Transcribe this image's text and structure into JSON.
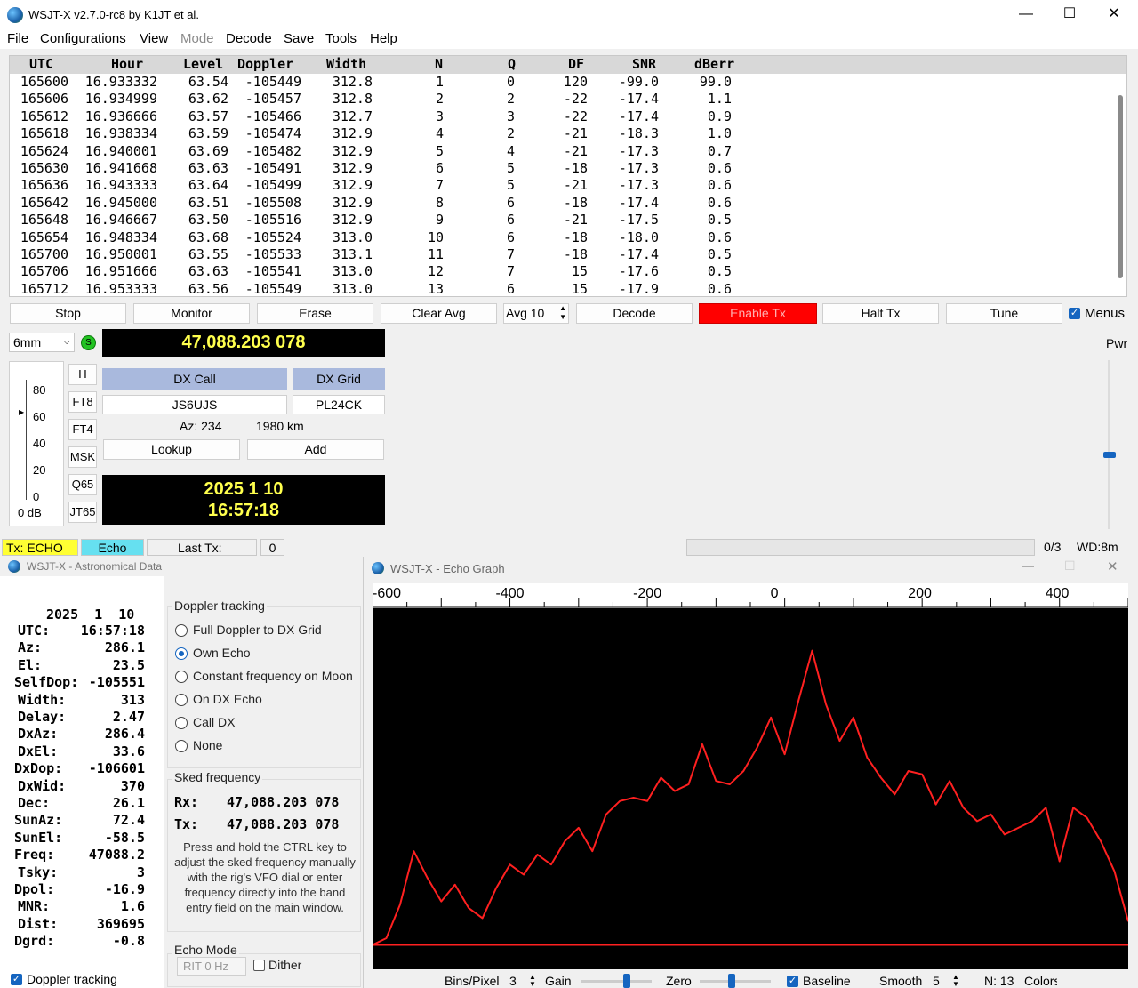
{
  "main": {
    "title": "WSJT-X   v2.7.0-rc8   by K1JT et al.",
    "menu": [
      "File",
      "Configurations",
      "View",
      "Mode",
      "Decode",
      "Save",
      "Tools",
      "Help"
    ],
    "table": {
      "headers": [
        "UTC",
        "Hour",
        "Level",
        "Doppler",
        "Width",
        "N",
        "Q",
        "DF",
        "SNR",
        "dBerr"
      ],
      "rows": [
        [
          "165600",
          "16.933332",
          "63.54",
          "-105449",
          "312.8",
          "1",
          "0",
          "120",
          "-99.0",
          "99.0"
        ],
        [
          "165606",
          "16.934999",
          "63.62",
          "-105457",
          "312.8",
          "2",
          "2",
          "-22",
          "-17.4",
          "1.1"
        ],
        [
          "165612",
          "16.936666",
          "63.57",
          "-105466",
          "312.7",
          "3",
          "3",
          "-22",
          "-17.4",
          "0.9"
        ],
        [
          "165618",
          "16.938334",
          "63.59",
          "-105474",
          "312.9",
          "4",
          "2",
          "-21",
          "-18.3",
          "1.0"
        ],
        [
          "165624",
          "16.940001",
          "63.69",
          "-105482",
          "312.9",
          "5",
          "4",
          "-21",
          "-17.3",
          "0.7"
        ],
        [
          "165630",
          "16.941668",
          "63.63",
          "-105491",
          "312.9",
          "6",
          "5",
          "-18",
          "-17.3",
          "0.6"
        ],
        [
          "165636",
          "16.943333",
          "63.64",
          "-105499",
          "312.9",
          "7",
          "5",
          "-21",
          "-17.3",
          "0.6"
        ],
        [
          "165642",
          "16.945000",
          "63.51",
          "-105508",
          "312.9",
          "8",
          "6",
          "-18",
          "-17.4",
          "0.6"
        ],
        [
          "165648",
          "16.946667",
          "63.50",
          "-105516",
          "312.9",
          "9",
          "6",
          "-21",
          "-17.5",
          "0.5"
        ],
        [
          "165654",
          "16.948334",
          "63.68",
          "-105524",
          "313.0",
          "10",
          "6",
          "-18",
          "-18.0",
          "0.6"
        ],
        [
          "165700",
          "16.950001",
          "63.55",
          "-105533",
          "313.1",
          "11",
          "7",
          "-18",
          "-17.4",
          "0.5"
        ],
        [
          "165706",
          "16.951666",
          "63.63",
          "-105541",
          "313.0",
          "12",
          "7",
          "15",
          "-17.6",
          "0.5"
        ],
        [
          "165712",
          "16.953333",
          "63.56",
          "-105549",
          "313.0",
          "13",
          "6",
          "15",
          "-17.9",
          "0.6"
        ]
      ]
    },
    "buttons": {
      "stop": "Stop",
      "monitor": "Monitor",
      "erase": "Erase",
      "clear_avg": "Clear Avg",
      "avg": "Avg 10",
      "decode": "Decode",
      "enable_tx": "Enable Tx",
      "halt_tx": "Halt Tx",
      "tune": "Tune",
      "menus": "Menus"
    },
    "band": "6mm",
    "s_label": "S",
    "frequency": "47,088.203 078",
    "pwr_label": "Pwr",
    "meter": {
      "ticks": [
        "80",
        "60",
        "40",
        "20",
        "0"
      ],
      "db_label": "0 dB"
    },
    "modes": [
      "H",
      "FT8",
      "FT4",
      "MSK",
      "Q65",
      "JT65"
    ],
    "dx": {
      "call_label": "DX Call",
      "grid_label": "DX Grid",
      "call": "JS6UJS",
      "grid": "PL24CK",
      "az": "Az: 234",
      "dist": "1980 km",
      "lookup": "Lookup",
      "add": "Add"
    },
    "clock": {
      "date": "2025  1  10",
      "time": "16:57:18"
    },
    "status": {
      "tx": "Tx: ECHO",
      "mode": "Echo",
      "last_tx": "Last Tx:",
      "count": "0",
      "progress": "0/3",
      "wd": "WD:8m"
    }
  },
  "astro": {
    "title": "WSJT-X - Astronomical Data",
    "date": "2025  1  10",
    "rows": [
      {
        "label": "UTC:",
        "value": "16:57:18"
      },
      {
        "label": "Az:",
        "value": "286.1"
      },
      {
        "label": "El:",
        "value": "23.5"
      },
      {
        "label": "SelfDop:",
        "value": "-105551"
      },
      {
        "label": "Width:",
        "value": "313"
      },
      {
        "label": "Delay:",
        "value": "2.47"
      },
      {
        "label": "DxAz:",
        "value": "286.4"
      },
      {
        "label": "DxEl:",
        "value": "33.6"
      },
      {
        "label": "DxDop:",
        "value": "-106601"
      },
      {
        "label": "DxWid:",
        "value": "370"
      },
      {
        "label": "Dec:",
        "value": "26.1"
      },
      {
        "label": "SunAz:",
        "value": "72.4"
      },
      {
        "label": "SunEl:",
        "value": "-58.5"
      },
      {
        "label": "Freq:",
        "value": "47088.2"
      },
      {
        "label": "Tsky:",
        "value": "3"
      },
      {
        "label": "Dpol:",
        "value": "-16.9"
      },
      {
        "label": "MNR:",
        "value": "1.6"
      },
      {
        "label": "Dist:",
        "value": "369695"
      },
      {
        "label": "Dgrd:",
        "value": "-0.8"
      }
    ],
    "doppler_title": "Doppler tracking",
    "doppler_options": [
      "Full Doppler to DX Grid",
      "Own Echo",
      "Constant frequency on Moon",
      "On DX Echo",
      "Call DX",
      "None"
    ],
    "doppler_selected": 1,
    "sked_title": "Sked frequency",
    "sked_rx_label": "Rx:",
    "sked_rx": "47,088.203 078",
    "sked_tx_label": "Tx:",
    "sked_tx": "47,088.203 078",
    "sked_help": "Press and hold the CTRL key to adjust the sked frequency manually with the rig's VFO dial or enter frequency directly into the band entry field on the main window.",
    "echo_mode_title": "Echo Mode",
    "rit": "RIT  0  Hz",
    "dither": "Dither",
    "doppler_checkbox": "Doppler tracking"
  },
  "echo": {
    "title": "WSJT-X - Echo Graph",
    "axis_ticks": [
      "-600",
      "-400",
      "-200",
      "0",
      "200",
      "400"
    ],
    "controls": {
      "bins_label": "Bins/Pixel",
      "bins_value": "3",
      "gain_label": "Gain",
      "zero_label": "Zero",
      "baseline_label": "Baseline",
      "smooth_label": "Smooth",
      "smooth_value": "5",
      "n_label": "N: 13",
      "colors_label": "Colors"
    }
  },
  "chart_data": {
    "type": "line",
    "xlim": [
      -600,
      500
    ],
    "xticks": [
      -600,
      -400,
      -200,
      0,
      200,
      400
    ],
    "series": [
      {
        "color": "#ff2020",
        "x": [
          -600,
          -580,
          -560,
          -540,
          -520,
          -500,
          -480,
          -460,
          -440,
          -420,
          -400,
          -380,
          -360,
          -340,
          -320,
          -300,
          -280,
          -260,
          -240,
          -220,
          -200,
          -180,
          -160,
          -140,
          -120,
          -100,
          -80,
          -60,
          -40,
          -20,
          0,
          20,
          40,
          60,
          80,
          100,
          120,
          140,
          160,
          180,
          200,
          220,
          240,
          260,
          280,
          300,
          320,
          340,
          360,
          380,
          400,
          420,
          440,
          460,
          480,
          500
        ],
        "y": [
          2,
          4,
          14,
          30,
          22,
          15,
          20,
          13,
          10,
          19,
          26,
          23,
          29,
          26,
          33,
          37,
          30,
          41,
          45,
          46,
          45,
          52,
          48,
          50,
          62,
          51,
          50,
          54,
          61,
          70,
          59,
          75,
          90,
          74,
          63,
          70,
          58,
          52,
          47,
          54,
          53,
          44,
          51,
          43,
          39,
          41,
          35,
          37,
          39,
          43,
          27,
          43,
          40,
          33,
          24,
          9
        ]
      }
    ],
    "baseline": 2
  }
}
